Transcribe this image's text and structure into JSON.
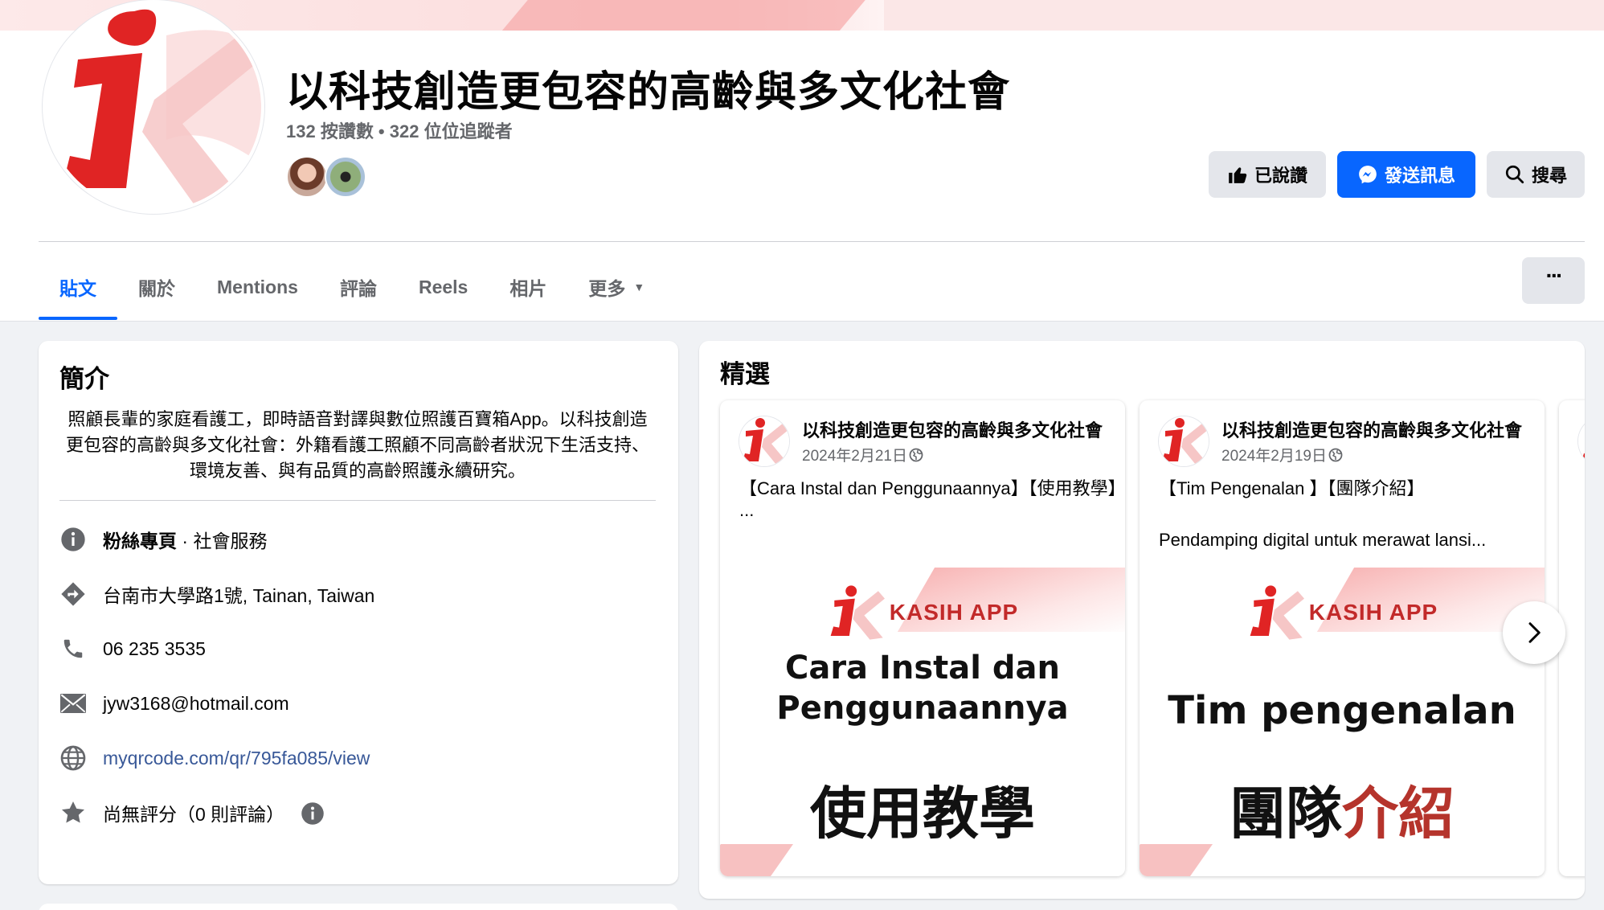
{
  "page": {
    "title": "以科技創造更包容的高齡與多文化社會",
    "stats": "132 按讚數 • 322 位位追蹤者"
  },
  "header_buttons": {
    "liked": "已說讚",
    "message": "發送訊息",
    "search": "搜尋"
  },
  "tabs": [
    {
      "label": "貼文",
      "active": true
    },
    {
      "label": "關於"
    },
    {
      "label": "Mentions"
    },
    {
      "label": "評論"
    },
    {
      "label": "Reels"
    },
    {
      "label": "相片"
    },
    {
      "label": "更多"
    }
  ],
  "intro": {
    "title": "簡介",
    "bio": "照顧長輩的家庭看護工，即時語音對譯與數位照護百寶箱App。以科技創造更包容的高齡與多文化社會：外籍看護工照顧不同高齡者狀況下生活支持、環境友善、與有品質的高齡照護永續研究。",
    "category_bold": "粉絲專頁",
    "category_rest": " · 社會服務",
    "address": "台南市大學路1號, Tainan, Taiwan",
    "phone": "06 235 3535",
    "email": "jyw3168@hotmail.com",
    "website": "myqrcode.com/qr/795fa085/view",
    "rating": "尚無評分（0 則評論）"
  },
  "featured": {
    "title": "精選",
    "posts": [
      {
        "author": "以科技創造更包容的高齡與多文化社會",
        "date": "2024年2月21日",
        "text": "【Cara Instal dan Penggunaannya】【使用教學】",
        "ellipsis": "...",
        "brand": "KASIH APP",
        "headline_1": "Cara Instal dan",
        "headline_2": "Penggunaannya",
        "zh": "使用教學"
      },
      {
        "author": "以科技創造更包容的高齡與多文化社會",
        "date": "2024年2月19日",
        "text": "【Tim Pengenalan 】【團隊介紹】",
        "text_2": "Pendamping digital untuk merawat lansi...",
        "brand": "KASIH APP",
        "headline_1": "Tim pengenalan",
        "zh_1": "團隊",
        "zh_2": "介紹"
      }
    ]
  },
  "colors": {
    "accent": "#0866ff",
    "brand_red": "#e02424",
    "background": "#f0f2f5"
  },
  "icons": [
    "thumbs-up-icon",
    "messenger-icon",
    "search-icon",
    "ellipsis-icon",
    "info-icon",
    "directions-icon",
    "phone-icon",
    "mail-icon",
    "globe-icon",
    "star-icon",
    "chevron-right-icon",
    "globe-privacy-icon"
  ]
}
